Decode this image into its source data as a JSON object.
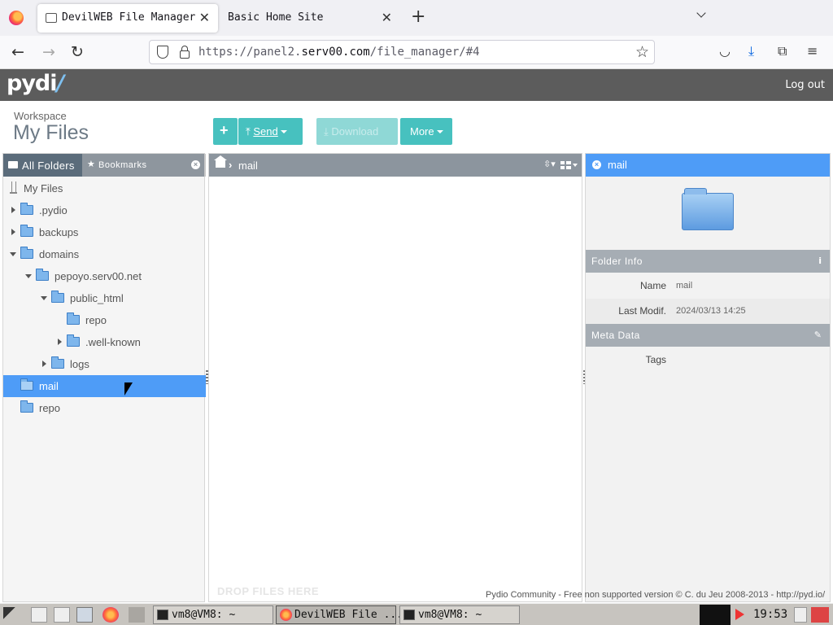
{
  "browser": {
    "tabs": [
      {
        "title": "DevilWEB File Manager",
        "active": true
      },
      {
        "title": "Basic Home Site",
        "active": false
      }
    ],
    "close_glyph": "✕",
    "new_tab_glyph": "+",
    "url_prefix": "https://panel2.",
    "url_domain": "serv00.com",
    "url_path": "/file_manager/#4"
  },
  "header": {
    "logo_text": "pydi",
    "logo_slash": "/",
    "logout_label": "Log out"
  },
  "workspace": {
    "label": "Workspace",
    "title": "My Files"
  },
  "actions": {
    "new_label": "+",
    "send_label": "Send",
    "download_label": "Download",
    "more_label": "More"
  },
  "left_pane": {
    "tab_all": "All Folders",
    "tab_bookmarks": "Bookmarks",
    "tree": [
      {
        "label": "My Files",
        "depth": 0,
        "icon": "disk-icon",
        "toggle": "none",
        "selected": false
      },
      {
        "label": ".pydio",
        "depth": 1,
        "icon": "folder-icon",
        "toggle": "collapsed",
        "selected": false
      },
      {
        "label": "backups",
        "depth": 1,
        "icon": "folder-icon",
        "toggle": "collapsed",
        "selected": false
      },
      {
        "label": "domains",
        "depth": 1,
        "icon": "folder-icon",
        "toggle": "expanded",
        "selected": false
      },
      {
        "label": "pepoyo.serv00.net",
        "depth": 2,
        "icon": "folder-icon",
        "toggle": "expanded",
        "selected": false
      },
      {
        "label": "public_html",
        "depth": 3,
        "icon": "folder-icon",
        "toggle": "expanded",
        "selected": false
      },
      {
        "label": "repo",
        "depth": 4,
        "icon": "folder-icon",
        "toggle": "none",
        "selected": false
      },
      {
        "label": ".well-known",
        "depth": 4,
        "icon": "folder-icon",
        "toggle": "collapsed",
        "selected": false
      },
      {
        "label": "logs",
        "depth": 3,
        "icon": "folder-icon",
        "toggle": "collapsed",
        "selected": false
      },
      {
        "label": "mail",
        "depth": 1,
        "icon": "folder-icon",
        "toggle": "none",
        "selected": true
      },
      {
        "label": "repo",
        "depth": 1,
        "icon": "folder-icon",
        "toggle": "none",
        "selected": false
      }
    ]
  },
  "center_pane": {
    "breadcrumb_sep": "›",
    "breadcrumb": "mail",
    "sort_glyph": "⇳▾",
    "drop_hint": "DROP FILES HERE"
  },
  "right_pane": {
    "title": "mail",
    "folder_info_title": "Folder Info",
    "info_glyph": "i",
    "rows": [
      {
        "key": "Name",
        "value": "mail"
      },
      {
        "key": "Last Modif.",
        "value": "2024/03/13 14:25"
      }
    ],
    "meta_title": "Meta Data",
    "edit_glyph": "✎",
    "meta_rows": [
      {
        "key": "Tags",
        "value": ""
      }
    ]
  },
  "footer": {
    "credit": "Pydio Community - Free non supported version © C. du Jeu 2008-2013 - http://pyd.io/"
  },
  "taskbar": {
    "tasks": [
      {
        "label": "vm8@VM8: ~",
        "icon": "terminal-icon",
        "active": false
      },
      {
        "label": "DevilWEB File ...",
        "icon": "firefox-icon",
        "active": true
      },
      {
        "label": "vm8@VM8: ~",
        "icon": "terminal-icon",
        "active": false
      }
    ],
    "clock": "19:53"
  },
  "colors": {
    "accent_blue": "#4e9cf7",
    "button_teal": "#47c1bf",
    "header_gray": "#5c5c5c"
  }
}
